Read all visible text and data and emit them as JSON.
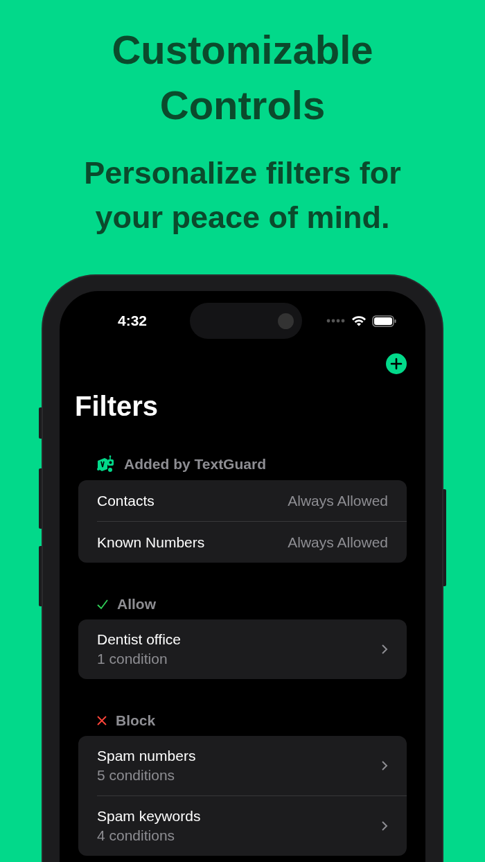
{
  "headline": "Customizable Controls",
  "subheadline": "Personalize filters for your peace of mind.",
  "status_bar": {
    "time": "4:32"
  },
  "screen": {
    "title": "Filters",
    "sections": [
      {
        "kind": "app",
        "header": "Added by TextGuard",
        "items": [
          {
            "kind": "value",
            "label": "Contacts",
            "value": "Always Allowed"
          },
          {
            "kind": "value",
            "label": "Known Numbers",
            "value": "Always Allowed"
          }
        ]
      },
      {
        "kind": "allow",
        "header": "Allow",
        "items": [
          {
            "kind": "nav",
            "label": "Dentist office",
            "detail": "1 condition"
          }
        ]
      },
      {
        "kind": "block",
        "header": "Block",
        "items": [
          {
            "kind": "nav",
            "label": "Spam numbers",
            "detail": "5 conditions"
          },
          {
            "kind": "nav",
            "label": "Spam keywords",
            "detail": "4 conditions"
          }
        ]
      }
    ]
  }
}
